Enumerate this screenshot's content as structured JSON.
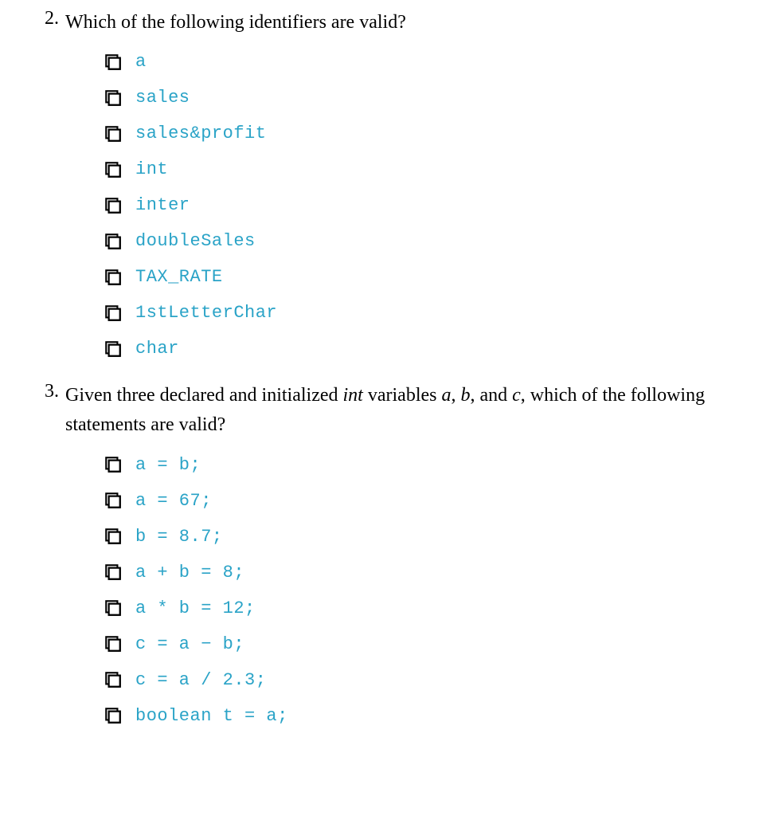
{
  "questions": [
    {
      "number": "2.",
      "prompt_html": "Which of the following identifiers are valid?",
      "options": [
        "a",
        "sales",
        "sales&profit",
        "int",
        "inter",
        "doubleSales",
        "TAX_RATE",
        "1stLetterChar",
        "char"
      ]
    },
    {
      "number": "3.",
      "prompt_html": "Given three declared and initialized <span class=\"ital\">int</span> variables <span class=\"ital\">a</span>, <span class=\"ital\">b</span>, and <span class=\"ital\">c</span>, which of the following statements are valid?",
      "options": [
        "a = b;",
        "a = 67;",
        "b = 8.7;",
        "a + b = 8;",
        "a * b = 12;",
        "c = a − b;",
        "c = a / 2.3;",
        "boolean t = a;"
      ]
    }
  ]
}
